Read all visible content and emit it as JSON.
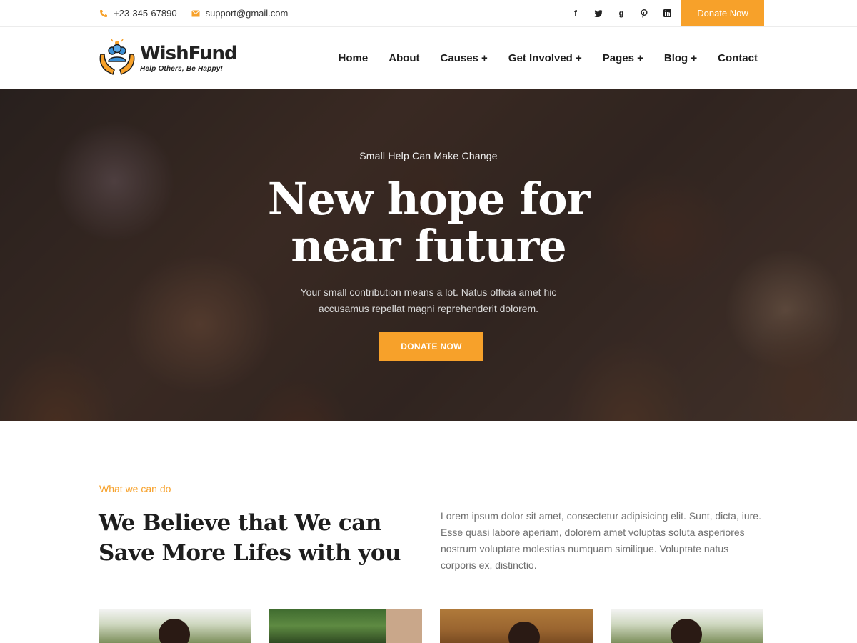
{
  "topbar": {
    "phone": "+23-345-67890",
    "email": "support@gmail.com",
    "social_icons": [
      "facebook-icon",
      "twitter-icon",
      "google-plus-icon",
      "pinterest-icon",
      "linkedin-icon"
    ],
    "donate_label": "Donate Now"
  },
  "brand": {
    "name": "WishFund",
    "tagline": "Help Others, Be Happy!"
  },
  "nav": {
    "items": [
      "Home",
      "About",
      "Causes +",
      "Get Involved +",
      "Pages +",
      "Blog +",
      "Contact"
    ]
  },
  "hero": {
    "eyebrow": "Small Help Can Make Change",
    "title_line1": "New hope for",
    "title_line2": "near future",
    "subtitle": "Your small contribution means a lot. Natus officia amet hic accusamus repellat magni reprehenderit dolorem.",
    "button_label": "DONATE NOW"
  },
  "about": {
    "eyebrow": "What we can do",
    "title_line1": "We Believe that We can",
    "title_line2": "Save More Lifes with you",
    "text": "Lorem ipsum dolor sit amet, consectetur adipisicing elit. Sunt, dicta, iure. Esse quasi labore aperiam, dolorem amet voluptas soluta asperiores nostrum voluptate molestias numquam similique. Voluptate natus corporis ex, distinctio."
  },
  "colors": {
    "accent": "#f7a12a",
    "heading": "#1e1e1e",
    "body_text": "#6f6f6f"
  }
}
